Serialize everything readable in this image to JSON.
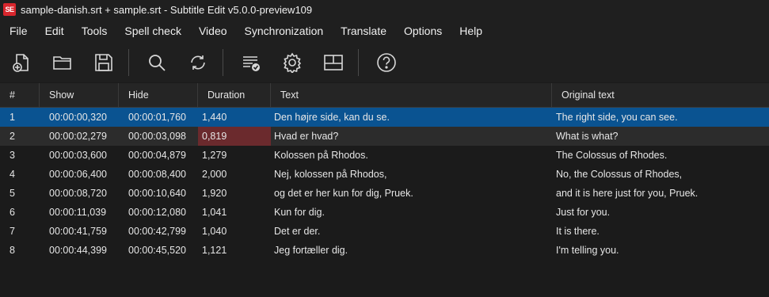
{
  "window": {
    "title": "sample-danish.srt + sample.srt - Subtitle Edit v5.0.0-preview109",
    "app_icon_text": "SE"
  },
  "menu": [
    "File",
    "Edit",
    "Tools",
    "Spell check",
    "Video",
    "Synchronization",
    "Translate",
    "Options",
    "Help"
  ],
  "toolbar": {
    "icons": [
      "new-file-icon",
      "open-folder-icon",
      "save-icon",
      "find-icon",
      "replace-icon",
      "spell-check-icon",
      "settings-icon",
      "layout-icon",
      "help-icon"
    ]
  },
  "grid": {
    "headers": [
      "#",
      "Show",
      "Hide",
      "Duration",
      "Text",
      "Original text"
    ],
    "rows": [
      {
        "num": "1",
        "show": "00:00:00,320",
        "hide": "00:00:01,760",
        "duration": "1,440",
        "text": "Den højre side, kan du se.",
        "original": "The right side, you can see."
      },
      {
        "num": "2",
        "show": "00:00:02,279",
        "hide": "00:00:03,098",
        "duration": "0,819",
        "text": "Hvad er hvad?",
        "original": "What is what?"
      },
      {
        "num": "3",
        "show": "00:00:03,600",
        "hide": "00:00:04,879",
        "duration": "1,279",
        "text": "Kolossen på Rhodos.",
        "original": "The Colossus of Rhodes."
      },
      {
        "num": "4",
        "show": "00:00:06,400",
        "hide": "00:00:08,400",
        "duration": "2,000",
        "text": "Nej, kolossen på Rhodos,",
        "original": "No, the Colossus of Rhodes,"
      },
      {
        "num": "5",
        "show": "00:00:08,720",
        "hide": "00:00:10,640",
        "duration": "1,920",
        "text": "og det er her kun for dig, Pruek.",
        "original": "and it is here just for you, Pruek."
      },
      {
        "num": "6",
        "show": "00:00:11,039",
        "hide": "00:00:12,080",
        "duration": "1,041",
        "text": "Kun for dig.",
        "original": "Just for you."
      },
      {
        "num": "7",
        "show": "00:00:41,759",
        "hide": "00:00:42,799",
        "duration": "1,040",
        "text": "Det er der.",
        "original": "It is there."
      },
      {
        "num": "8",
        "show": "00:00:44,399",
        "hide": "00:00:45,520",
        "duration": "1,121",
        "text": "Jeg fortæller dig.",
        "original": "I'm telling you."
      }
    ]
  },
  "colors": {
    "selected_row": "#0a5391",
    "duration_warning": "#6b2a2d",
    "background": "#1b1b1b"
  }
}
